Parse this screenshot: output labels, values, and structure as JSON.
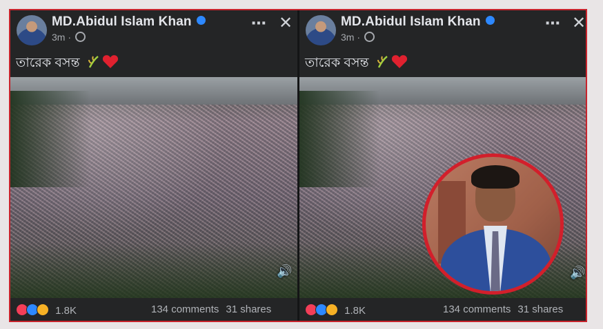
{
  "posts": [
    {
      "author": "MD.Abidul Islam Khan",
      "time": "3m",
      "caption": "তারেক বসন্ত",
      "reaction_count": "1.8K",
      "comments": "134 comments",
      "shares": "31 shares",
      "has_inset_photo": false
    },
    {
      "author": "MD.Abidul Islam Khan",
      "time": "3m",
      "caption": "তারেক বসন্ত",
      "reaction_count": "1.8K",
      "comments": "134 comments",
      "shares": "31 shares",
      "has_inset_photo": true
    }
  ],
  "icons": {
    "more": "⋯",
    "close": "✕",
    "speaker": "🔊",
    "heart": "❤",
    "meta_separator": "·"
  },
  "colors": {
    "frame_border": "#c8232c",
    "post_background": "#242526",
    "verified_badge": "#2d88ff",
    "heart": "#e0212f",
    "inset_ring": "#d21f2b"
  }
}
